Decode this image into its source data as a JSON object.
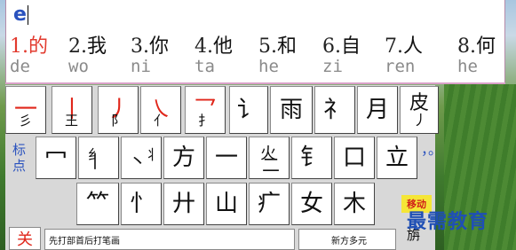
{
  "ime": {
    "composition": "e",
    "candidates": [
      {
        "num": "1.",
        "char": "的",
        "pinyin": "de"
      },
      {
        "num": "2.",
        "char": "我",
        "pinyin": "wo"
      },
      {
        "num": "3.",
        "char": "你",
        "pinyin": "ni"
      },
      {
        "num": "4.",
        "char": "他",
        "pinyin": "ta"
      },
      {
        "num": "5.",
        "char": "和",
        "pinyin": "he"
      },
      {
        "num": "6.",
        "char": "自",
        "pinyin": "zi"
      },
      {
        "num": "7.",
        "char": "人",
        "pinyin": "ren"
      },
      {
        "num": "8.",
        "char": "何",
        "pinyin": "he"
      }
    ]
  },
  "keyboard": {
    "row1": [
      {
        "main": "一",
        "sub": "彡"
      },
      {
        "main": "丨",
        "sub": "王"
      },
      {
        "main": "丿",
        "sub": "阝"
      },
      {
        "main": "㇏",
        "sub": "亻"
      },
      {
        "main": "乛",
        "sub": "扌"
      },
      {
        "main": "讠",
        "sub": ""
      },
      {
        "main": "雨",
        "sub": ""
      },
      {
        "main": "礻",
        "sub": ""
      },
      {
        "main": "月",
        "sub": ""
      },
      {
        "main": "皮",
        "sub": "丿"
      }
    ],
    "side_label": "标点",
    "row2": [
      {
        "a": "冖",
        "b": ""
      },
      {
        "a": "纟",
        "b": "丨"
      },
      {
        "a": "丬",
        "b": "丶"
      },
      {
        "a": "方",
        "b": ""
      },
      {
        "a": "一",
        "b": ""
      },
      {
        "a": "火",
        "b": "二"
      },
      {
        "a": "钅",
        "b": ""
      },
      {
        "a": "口",
        "b": ""
      },
      {
        "a": "立",
        "b": ""
      }
    ],
    "row2_punct": "，。",
    "row3": [
      "⺮",
      "忄",
      "廾",
      "山",
      "疒",
      "女",
      "木"
    ],
    "close_label": "关",
    "bar_left": "先打部首后打笔画",
    "bar_right": "新方多元",
    "move_label": "移动",
    "move_sub": "旃"
  },
  "watermark": "最需教育"
}
